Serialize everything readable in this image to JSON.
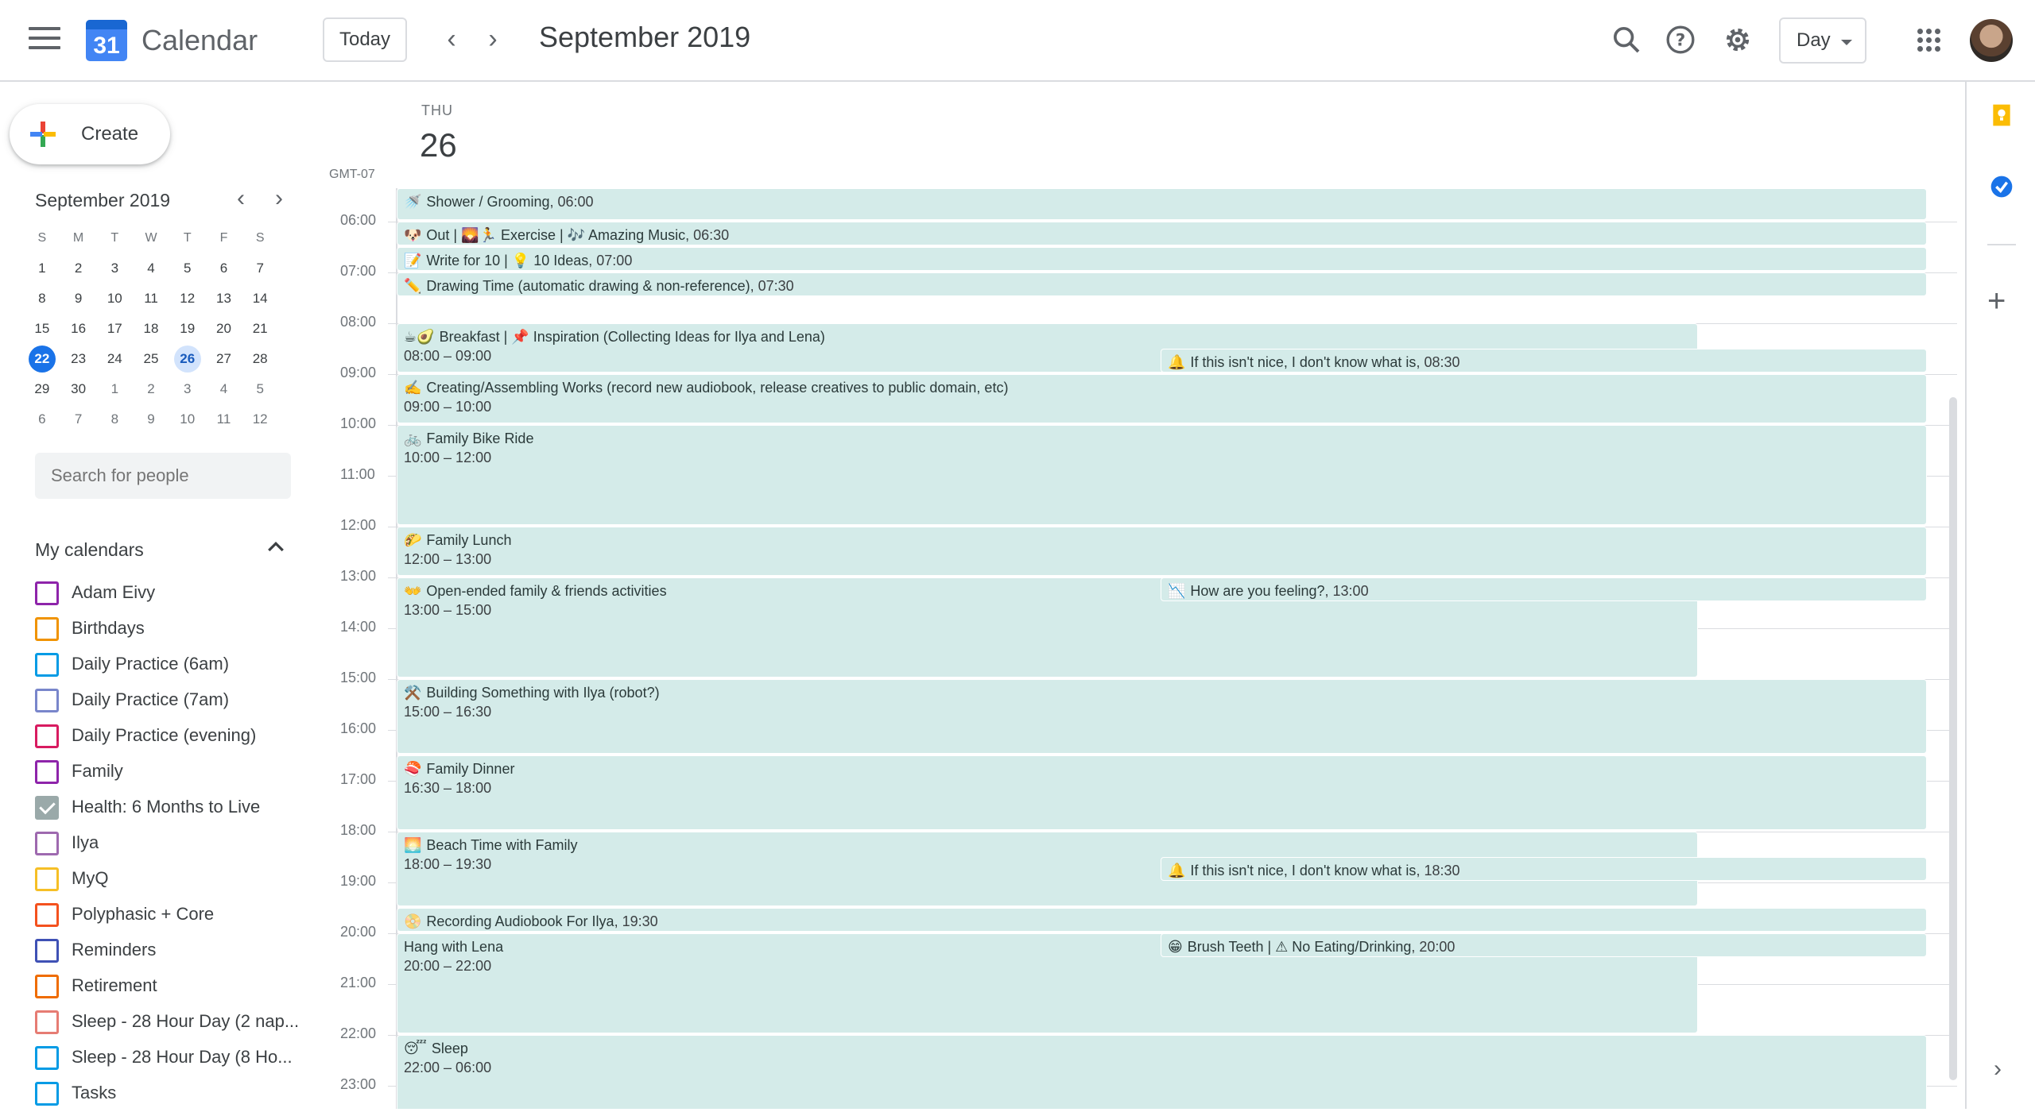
{
  "app": {
    "title": "Calendar",
    "logo_day": "31"
  },
  "toolbar": {
    "today": "Today",
    "prev": "‹",
    "next": "›",
    "current_date": "September 2019",
    "view": "Day"
  },
  "create": {
    "label": "Create"
  },
  "mini_calendar": {
    "title": "September 2019",
    "weekday_heads": [
      "S",
      "M",
      "T",
      "W",
      "T",
      "F",
      "S"
    ],
    "weeks": [
      [
        "1",
        "2",
        "3",
        "4",
        "5",
        "6",
        "7"
      ],
      [
        "8",
        "9",
        "10",
        "11",
        "12",
        "13",
        "14"
      ],
      [
        "15",
        "16",
        "17",
        "18",
        "19",
        "20",
        "21"
      ],
      [
        "22",
        "23",
        "24",
        "25",
        "26",
        "27",
        "28"
      ],
      [
        "29",
        "30",
        "1",
        "2",
        "3",
        "4",
        "5"
      ],
      [
        "6",
        "7",
        "8",
        "9",
        "10",
        "11",
        "12"
      ]
    ],
    "today": "22",
    "selected": "26"
  },
  "people_search": {
    "placeholder": "Search for people"
  },
  "my_calendars": {
    "title": "My calendars",
    "items": [
      {
        "label": "Adam Eivy",
        "color": "#8e24aa",
        "checked": false
      },
      {
        "label": "Birthdays",
        "color": "#f09300",
        "checked": false
      },
      {
        "label": "Daily Practice (6am)",
        "color": "#039be5",
        "checked": false
      },
      {
        "label": "Daily Practice (7am)",
        "color": "#7986cb",
        "checked": false
      },
      {
        "label": "Daily Practice (evening)",
        "color": "#d81b60",
        "checked": false
      },
      {
        "label": "Family",
        "color": "#8e24aa",
        "checked": false
      },
      {
        "label": "Health: 6 Months to Live",
        "color": "#9aa9a9",
        "checked": true
      },
      {
        "label": "Ilya",
        "color": "#9e69af",
        "checked": false
      },
      {
        "label": "MyQ",
        "color": "#f6bf26",
        "checked": false
      },
      {
        "label": "Polyphasic + Core",
        "color": "#f4511e",
        "checked": false
      },
      {
        "label": "Reminders",
        "color": "#3f51b5",
        "checked": false
      },
      {
        "label": "Retirement",
        "color": "#ef6c00",
        "checked": false
      },
      {
        "label": "Sleep - 28 Hour Day (2 nap...",
        "color": "#e67c73",
        "checked": false
      },
      {
        "label": "Sleep - 28 Hour Day (8 Ho...",
        "color": "#039be5",
        "checked": false
      },
      {
        "label": "Tasks",
        "color": "#039be5",
        "checked": false
      }
    ]
  },
  "day_view": {
    "weekday": "THU",
    "day_number": "26",
    "timezone": "GMT-07",
    "hours": [
      "06:00",
      "07:00",
      "08:00",
      "09:00",
      "10:00",
      "11:00",
      "12:00",
      "13:00",
      "14:00",
      "15:00",
      "16:00",
      "17:00",
      "18:00",
      "19:00",
      "20:00",
      "21:00",
      "22:00",
      "23:00"
    ]
  },
  "events": [
    {
      "emoji": "🚿",
      "title": "Shower / Grooming",
      "time": ", 06:00",
      "range": ""
    },
    {
      "emoji": "🐶",
      "title": "Out | 🌄🏃 Exercise | 🎶 Amazing Music",
      "time": ", 06:30",
      "range": ""
    },
    {
      "emoji": "📝",
      "title": "Write for 10 | 💡 10 Ideas",
      "time": ", 07:00",
      "range": ""
    },
    {
      "emoji": "✏️",
      "title": "Drawing Time (automatic drawing & non-reference)",
      "time": ", 07:30",
      "range": ""
    },
    {
      "emoji": "☕🥑",
      "title": "Breakfast | 📌 Inspiration (Collecting Ideas for Ilya and Lena)",
      "time": "",
      "range": "08:00 – 09:00"
    },
    {
      "emoji": "🔔",
      "title": "If this isn't nice, I don't know what is",
      "time": ", 08:30",
      "range": ""
    },
    {
      "emoji": "✍️",
      "title": "Creating/Assembling Works (record new audiobook, release creatives to public domain, etc)",
      "time": "",
      "range": "09:00 – 10:00"
    },
    {
      "emoji": "🚲",
      "title": "Family Bike Ride",
      "time": "",
      "range": "10:00 – 12:00"
    },
    {
      "emoji": "🌮",
      "title": "Family Lunch",
      "time": "",
      "range": "12:00 – 13:00"
    },
    {
      "emoji": "👐",
      "title": "Open-ended family & friends activities",
      "time": "",
      "range": "13:00 – 15:00"
    },
    {
      "emoji": "📉",
      "title": "How are you feeling?",
      "time": ", 13:00",
      "range": ""
    },
    {
      "emoji": "⚒️",
      "title": "Building Something with Ilya (robot?)",
      "time": "",
      "range": "15:00 – 16:30"
    },
    {
      "emoji": "🍣",
      "title": "Family Dinner",
      "time": "",
      "range": "16:30 – 18:00"
    },
    {
      "emoji": "🌅",
      "title": "Beach Time with Family",
      "time": "",
      "range": "18:00 – 19:30"
    },
    {
      "emoji": "🔔",
      "title": "If this isn't nice, I don't know what is",
      "time": ", 18:30",
      "range": ""
    },
    {
      "emoji": "📀",
      "title": "Recording Audiobook For Ilya",
      "time": ", 19:30",
      "range": ""
    },
    {
      "emoji": "",
      "title": "Hang with Lena",
      "time": "",
      "range": "20:00 – 22:00"
    },
    {
      "emoji": "😁",
      "title": "Brush Teeth | ⚠ No Eating/Drinking",
      "time": ", 20:00",
      "range": ""
    },
    {
      "emoji": "😴",
      "title": "Sleep",
      "time": "",
      "range": "22:00 – 06:00"
    }
  ],
  "colors": {
    "event_bg": "#d4ebe9",
    "accent": "#1a73e8"
  }
}
